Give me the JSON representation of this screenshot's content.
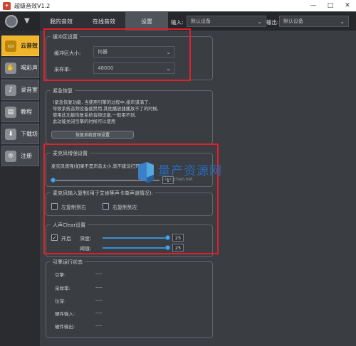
{
  "window": {
    "title": "超级音效V1.2",
    "app_icon": "flame-icon",
    "buttons": {
      "minimize": "—",
      "maximize": "□",
      "close": "✕"
    }
  },
  "topnav": {
    "logo_arrow": "▼",
    "tabs": [
      {
        "label": "我的音效"
      },
      {
        "label": "在线音效"
      },
      {
        "label": "设置",
        "active": true
      }
    ],
    "input": {
      "label": "输入:",
      "value": "默认设备"
    },
    "output": {
      "label": "输出:",
      "value": "默认设备"
    }
  },
  "sidebar": {
    "items": [
      {
        "label": "云音效",
        "icon": "folder-icon",
        "active": true
      },
      {
        "label": "喝彩声",
        "icon": "applause-icon"
      },
      {
        "label": "录音室",
        "icon": "microphone-icon"
      },
      {
        "label": "教程",
        "icon": "book-icon"
      },
      {
        "label": "下载坊",
        "icon": "download-icon"
      },
      {
        "label": "注册",
        "icon": "register-icon"
      }
    ]
  },
  "buffer": {
    "title": "缓冲区设置",
    "size_label": "缓冲区大小:",
    "size_value": "何器",
    "rate_label": "采样率:",
    "rate_value": "48000"
  },
  "emergency": {
    "title": "紧急恢复",
    "lines": [
      "!紧急恢复功能, 当使用引擎的过程中,接声道涌了,",
      "导致系统音频设备被禁用,其他播放器播放不了的时候,",
      "使用此功能恢复系统音频设备,一般用不到.",
      "此功能关闭引擎的时候可以使用"
    ],
    "button": "恢复系统音频设置"
  },
  "mic_boost": {
    "title": "麦克风增强设置",
    "desc": "麦克风增强(如果不是声音太小,就不建议打开)",
    "value": "1",
    "level": 0
  },
  "mic_copy": {
    "title": "麦克风输入复制(用于艾肯等声卡单声道情况):",
    "left_to_right": "左复制到右",
    "right_to_left": "右复制到左"
  },
  "voice_clear": {
    "title": "人声Clear设置",
    "enable_label": "开启",
    "enabled_mark": "✓",
    "depth_label": "深度:",
    "depth_value": "25",
    "depth_level": 1.0,
    "threshold_label": "阈值:",
    "threshold_value": "25",
    "threshold_level": 1.0
  },
  "engine_status": {
    "title": "引擎运行状态",
    "rows": [
      {
        "label": "引擎:",
        "value": "----"
      },
      {
        "label": "采样率:",
        "value": "----"
      },
      {
        "label": "位深:",
        "value": "----"
      },
      {
        "label": "硬件输入:",
        "value": "----"
      },
      {
        "label": "硬件输出:",
        "value": "----"
      }
    ]
  },
  "watermark": {
    "text": "量产资源网",
    "sub": "Liangchan.net"
  },
  "colors": {
    "accent": "#f0b52a",
    "annotation": "#e0202a",
    "slider": "#4aa6ec",
    "background": "#3a3d42"
  }
}
